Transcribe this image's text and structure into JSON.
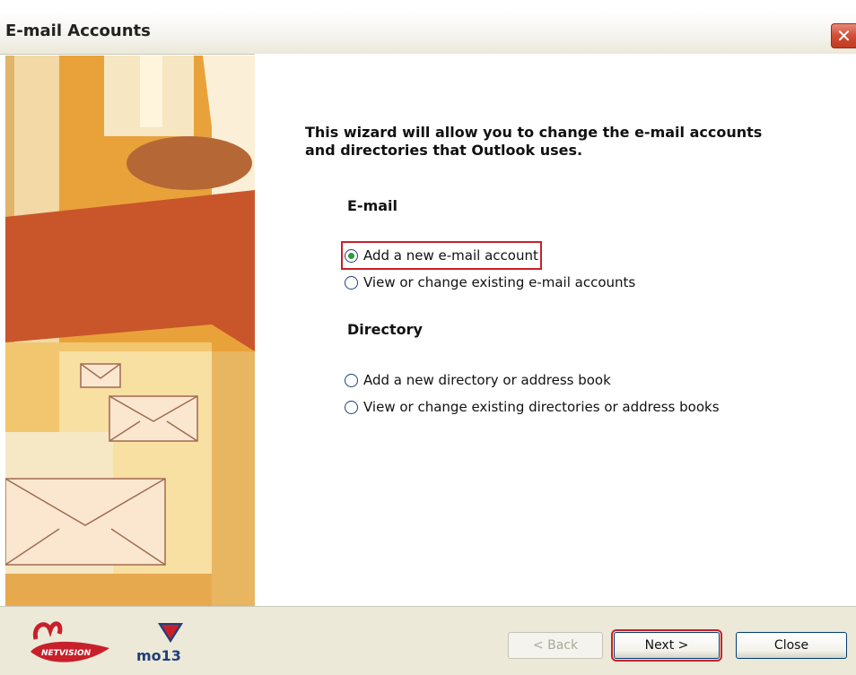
{
  "window": {
    "title": "E-mail Accounts",
    "close_glyph": "✕"
  },
  "intro": "This wizard will allow you to change the e-mail accounts and directories that Outlook uses.",
  "email_section": {
    "heading": "E-mail",
    "options": [
      {
        "label": "Add a new e-mail account",
        "checked": true
      },
      {
        "label": "View or change existing e-mail accounts",
        "checked": false
      }
    ]
  },
  "directory_section": {
    "heading": "Directory",
    "options": [
      {
        "label": "Add a new directory or address book",
        "checked": false
      },
      {
        "label": "View or change existing directories or address books",
        "checked": false
      }
    ]
  },
  "buttons": {
    "back": "< Back",
    "next": "Next >",
    "close": "Close"
  },
  "logos": {
    "netvision": "NETVISION",
    "mo13": "mo13"
  },
  "colors": {
    "highlight": "#c8202a",
    "radio_dot": "#2f9a36"
  }
}
